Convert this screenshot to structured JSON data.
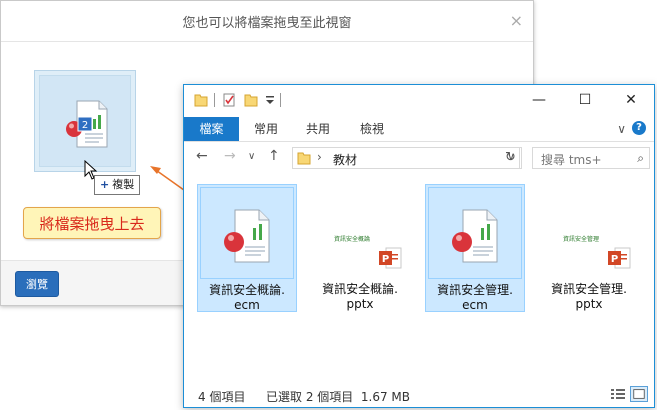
{
  "dialog": {
    "title": "您也可以將檔案拖曳至此視窗",
    "close_glyph": "×",
    "browse_label": "瀏覽",
    "ghost_badge": "2",
    "copy_tip_plus": "+",
    "copy_tip_label": "複製"
  },
  "callout": {
    "text": "將檔案拖曳上去"
  },
  "explorer": {
    "window_controls": {
      "minimize": "—",
      "maximize": "☐",
      "close": "✕"
    },
    "ribbon": {
      "tabs": [
        "檔案",
        "常用",
        "共用",
        "檢視"
      ],
      "chevron": "∨",
      "help": "?"
    },
    "nav": {
      "back": "←",
      "forward": "→",
      "recent": "∨",
      "up": "↑"
    },
    "address": {
      "separator": "›",
      "path": "教材",
      "dropdown": "∨",
      "refresh": "↻"
    },
    "search": {
      "placeholder": "搜尋 tms+",
      "icon": "⌕"
    },
    "files": [
      {
        "name_line1": "資訊安全概論.",
        "name_line2": "ecm",
        "selected": true,
        "type": "ecm"
      },
      {
        "name_line1": "資訊安全概論.",
        "name_line2": "pptx",
        "selected": false,
        "type": "pptx",
        "thumb_title": "資訊安全概論"
      },
      {
        "name_line1": "資訊安全管理.",
        "name_line2": "ecm",
        "selected": true,
        "type": "ecm"
      },
      {
        "name_line1": "資訊安全管理.",
        "name_line2": "pptx",
        "selected": false,
        "type": "pptx",
        "thumb_title": "資訊安全管理"
      }
    ],
    "status": {
      "count": "4 個項目",
      "selection": "已選取 2 個項目  1.67 MB"
    }
  },
  "colors": {
    "accent": "#1979ca",
    "callout_text": "#d9291b",
    "callout_bg": "#fff5b8",
    "arrow": "#e8742a",
    "selection": "#cce8ff"
  }
}
